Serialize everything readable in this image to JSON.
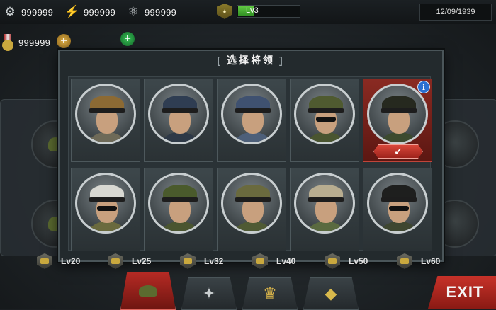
{
  "top_bar": {
    "resources": [
      {
        "icon": "gear-icon",
        "value": "999999"
      },
      {
        "icon": "lightning-icon",
        "value": "999999"
      },
      {
        "icon": "atom-icon",
        "value": "999999"
      }
    ],
    "level": "Lv3",
    "level_progress": 0.25,
    "date": "12/09/1939",
    "medals": {
      "icon": "medal-icon",
      "value": "999999"
    }
  },
  "dialog": {
    "title": "选择将领",
    "title_brackets": [
      "[",
      "]"
    ],
    "selected_index": 4,
    "generals": [
      {
        "hat_color": "#8c6a34",
        "uniform_color": "#6e6a58",
        "glasses": false
      },
      {
        "hat_color": "#2f3d52",
        "uniform_color": "#2e3947",
        "glasses": false
      },
      {
        "hat_color": "#3f5170",
        "uniform_color": "#4d5f79",
        "glasses": false
      },
      {
        "hat_color": "#4f5a30",
        "uniform_color": "#4a5530",
        "glasses": true
      },
      {
        "hat_color": "#26291f",
        "uniform_color": "#3c4a2f",
        "glasses": false,
        "info": true
      },
      {
        "hat_color": "#d8d8d2",
        "uniform_color": "#6a6a3e",
        "glasses": true
      },
      {
        "hat_color": "#4a5a2c",
        "uniform_color": "#4a5530",
        "glasses": false
      },
      {
        "hat_color": "#6a6a3e",
        "uniform_color": "#4f5a34",
        "glasses": false
      },
      {
        "hat_color": "#b8ad90",
        "uniform_color": "#5a6a40",
        "glasses": false
      },
      {
        "hat_color": "#1e1f1e",
        "uniform_color": "#3e4630",
        "glasses": true
      }
    ],
    "info_label": "i",
    "check_label": "✓"
  },
  "levels": [
    "Lv20",
    "Lv25",
    "Lv32",
    "Lv40",
    "Lv50",
    "Lv60"
  ],
  "bottom_tabs": [
    {
      "icon": "general-helmet-icon"
    },
    {
      "icon": "eagle-emblem-icon"
    },
    {
      "icon": "trophy-icon"
    },
    {
      "icon": "diamond-icon"
    }
  ],
  "exit_label": "EXIT"
}
